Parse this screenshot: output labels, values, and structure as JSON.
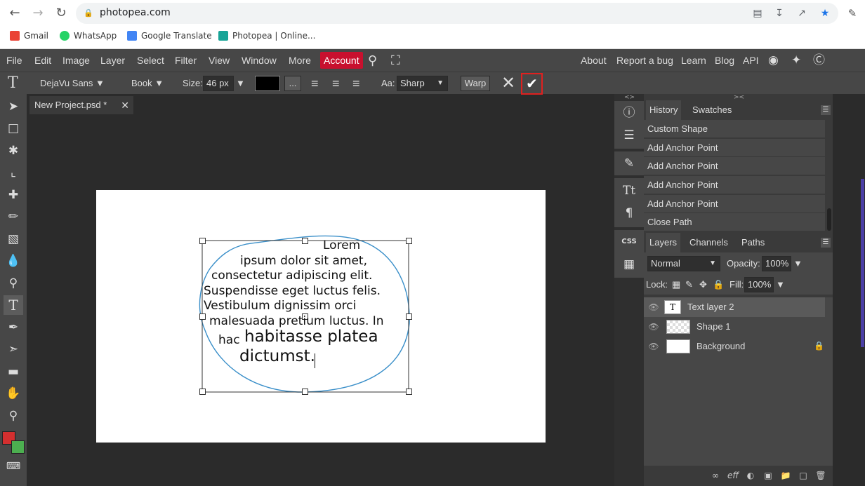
{
  "browser": {
    "url": "photopea.com",
    "bookmarks": [
      "Gmail",
      "WhatsApp",
      "Google Translate",
      "Photopea | Online..."
    ]
  },
  "menu": {
    "items": [
      "File",
      "Edit",
      "Image",
      "Layer",
      "Select",
      "Filter",
      "View",
      "Window",
      "More"
    ],
    "account": "Account",
    "right_links": [
      "About",
      "Report a bug",
      "Learn",
      "Blog",
      "API"
    ]
  },
  "options": {
    "font": "DejaVu Sans ▼",
    "weight": "Book ▼",
    "size_label": "Size:",
    "size_value": "46 px",
    "size_arrow": "▼",
    "more": "...",
    "aa_label": "Aa:",
    "aa_value": "Sharp",
    "warp": "Warp"
  },
  "document": {
    "tab_title": "New Project.psd *",
    "text_lines": [
      "Lorem",
      "ipsum dolor sit amet,",
      "consectetur adipiscing elit.",
      "Suspendisse eget luctus felis.",
      "Vestibulum dignissim orci",
      "malesuada pretium luctus. In",
      "hac",
      "habitasse platea",
      "dictumst."
    ]
  },
  "history": {
    "tabs": [
      "History",
      "Swatches"
    ],
    "items": [
      "Custom Shape",
      "Add Anchor Point",
      "Add Anchor Point",
      "Add Anchor Point",
      "Add Anchor Point",
      "Close Path"
    ]
  },
  "layers": {
    "tabs": [
      "Layers",
      "Channels",
      "Paths"
    ],
    "blend_mode": "Normal",
    "opacity_label": "Opacity:",
    "opacity_value": "100%",
    "lock_label": "Lock:",
    "fill_label": "Fill:",
    "fill_value": "100%",
    "items": [
      "Text layer 2",
      "Shape 1",
      "Background"
    ]
  },
  "colors": {
    "accent_red": "#c8102e",
    "foreground": "#d32f2f",
    "background_swatch": "#4caf50",
    "shape_stroke": "#3a8fc9"
  }
}
